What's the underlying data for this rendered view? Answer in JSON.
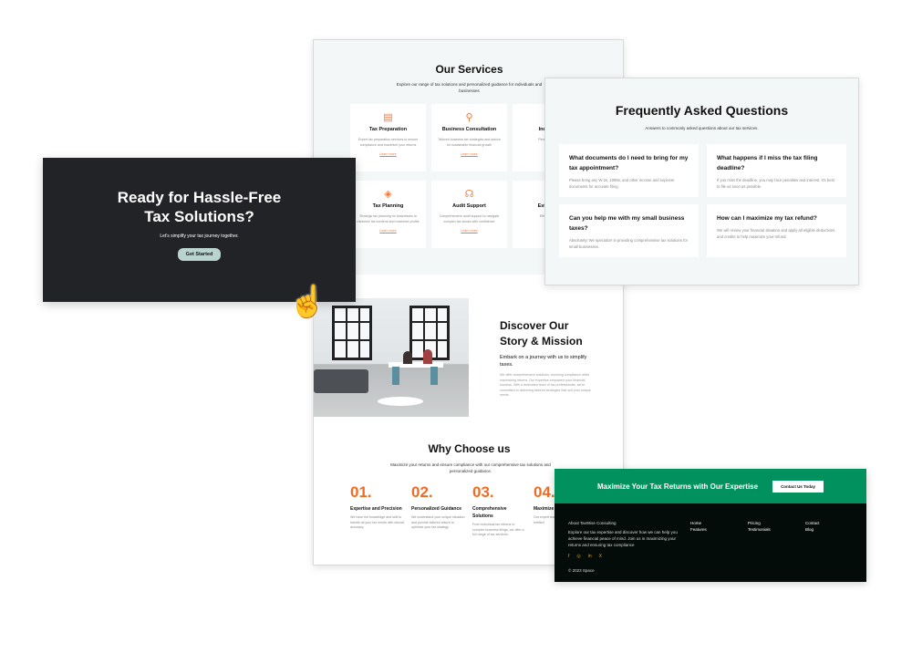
{
  "services": {
    "title": "Our Services",
    "subtitle": "Explore our range of tax solutions and personalized guidance for individuals and businesses",
    "cards": [
      {
        "icon": "document-icon",
        "title": "Tax Preparation",
        "desc": "Expert tax preparation services to ensure compliance and maximize your returns",
        "link": "Learn more"
      },
      {
        "icon": "consultant-icon",
        "title": "Business Consultation",
        "desc": "Tailored business tax strategies and advice for sustainable financial growth",
        "link": "Learn more"
      },
      {
        "icon": "user-icon",
        "title": "Individual",
        "desc": "Personalized tax",
        "link": "Le"
      },
      {
        "icon": "layers-icon",
        "title": "Tax Planning",
        "desc": "Strategic tax planning for businesses to minimize tax burdens and maximize profits",
        "link": "Learn more"
      },
      {
        "icon": "headset-icon",
        "title": "Audit Support",
        "desc": "Comprehensive audit support to navigate complex tax issues with confidence",
        "link": "Learn more"
      },
      {
        "icon": "estate-icon",
        "title": "Estate and",
        "desc": "Efficient estate",
        "link": "Le"
      }
    ]
  },
  "faq": {
    "title": "Frequently Asked Questions",
    "subtitle": "Answers to commonly asked questions about our tax services.",
    "items": [
      {
        "q": "What documents do I need to bring for my tax appointment?",
        "a": "Please bring any W-2s, 1099s, and other income and expense documents for accurate filing."
      },
      {
        "q": "What happens if I miss the tax filing deadline?",
        "a": "If you miss the deadline, you may face penalties and interest. It's best to file as soon as possible."
      },
      {
        "q": "Can you help me with my small business taxes?",
        "a": "Absolutely! We specialize in providing comprehensive tax solutions for small businesses."
      },
      {
        "q": "How can I maximize my tax refund?",
        "a": "We will review your financial situation and apply all eligible deductions and credits to help maximize your refund."
      }
    ]
  },
  "cta": {
    "title": "Ready for Hassle-Free Tax Solutions?",
    "subtitle": "Let's simplify your tax journey together.",
    "button": "Get Started"
  },
  "story": {
    "title": "Discover Our Story & Mission",
    "lead": "Embark on a journey with us to simplify taxes.",
    "body": "We offer comprehensive solutions, ensuring compliance while maximizing returns. Our expertise empowers your financial success. With a dedicated team of tax professionals, we're committed to delivering tailored strategies that suit your unique needs"
  },
  "why": {
    "title": "Why Choose us",
    "subtitle": "Maximize your returns and ensure compliance with our comprehensive tax solutions and personalized guidance.",
    "items": [
      {
        "n": "01.",
        "t": "Expertise and Precision",
        "d": "We have the knowledge and skill to handle all your tax needs with utmost accuracy."
      },
      {
        "n": "02.",
        "t": "Personalized Guidance",
        "d": "We understand your unique situation and provide tailored advice to optimize your tax strategy."
      },
      {
        "n": "03.",
        "t": "Comprehensive Solutions",
        "d": "From individual tax returns to complex business filings, we offer a full range of tax services."
      },
      {
        "n": "04.",
        "t": "Maximize",
        "d": "Our expert tea get every dedu you're entitled"
      }
    ]
  },
  "footer": {
    "banner": "Maximize Your Tax Returns with Our Expertise",
    "banner_button": "Contact Us Today",
    "about_title": "About TaxWise Consulting",
    "about_text": "Explore our tax expertise and discover how we can help you achieve financial peace of mind. Join us in maximizing your returns and ensuring tax compliance",
    "links": [
      [
        "Home",
        "Features"
      ],
      [
        "Pricing",
        "Testimonials"
      ],
      [
        "Contact",
        "Blog"
      ]
    ],
    "social": [
      "facebook-icon",
      "instagram-icon",
      "linkedin-icon",
      "x-icon"
    ],
    "copyright": "© 2023 Space",
    "colors": {
      "green": "#00915f",
      "dark": "#030c08",
      "social": "#e0a21e"
    }
  },
  "colors": {
    "accent": "#f26b21",
    "cta_bg": "#222326",
    "button": "#b9d4cf"
  }
}
